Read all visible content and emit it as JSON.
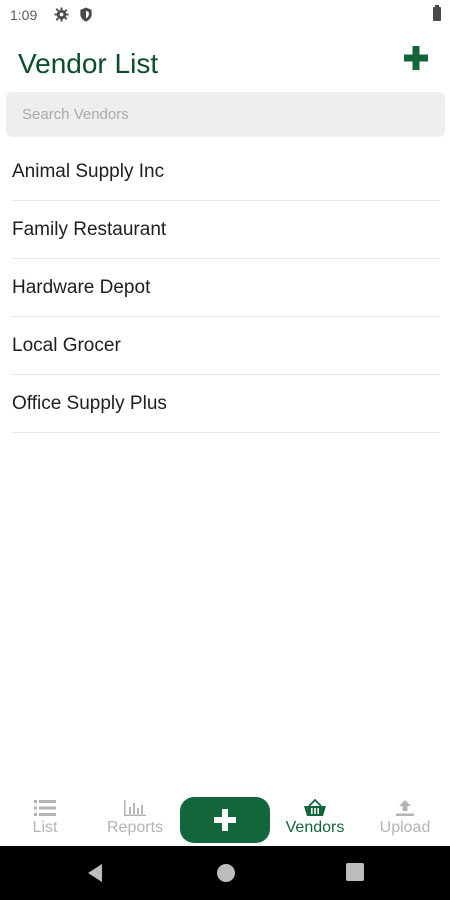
{
  "status_bar": {
    "time": "1:09",
    "icons": [
      "gear-icon",
      "shield-icon",
      "battery-icon"
    ]
  },
  "header": {
    "title": "Vendor List",
    "add_icon": "plus-icon"
  },
  "search": {
    "placeholder": "Search Vendors",
    "value": ""
  },
  "vendors": [
    {
      "name": "Animal Supply Inc"
    },
    {
      "name": "Family Restaurant"
    },
    {
      "name": "Hardware Depot"
    },
    {
      "name": "Local Grocer"
    },
    {
      "name": "Office Supply Plus"
    }
  ],
  "bottom_nav": {
    "items": [
      {
        "label": "List",
        "icon": "list-icon",
        "active": false
      },
      {
        "label": "Reports",
        "icon": "bar-chart-icon",
        "active": false
      },
      {
        "label": "",
        "icon": "plus-icon",
        "active": false
      },
      {
        "label": "Vendors",
        "icon": "basket-icon",
        "active": true
      },
      {
        "label": "Upload",
        "icon": "upload-icon",
        "active": false
      }
    ]
  },
  "colors": {
    "brand_green": "#12663a",
    "title_green": "#0c4d2c",
    "inactive_gray": "#b4b4b4",
    "search_bg": "#eeeeee"
  }
}
